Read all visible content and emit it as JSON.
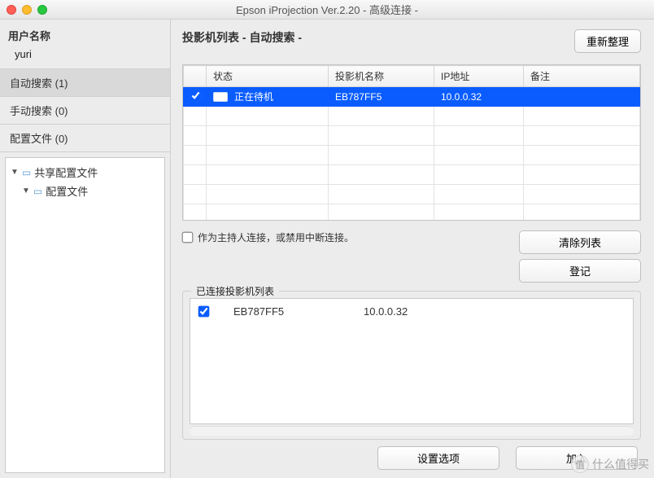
{
  "window": {
    "title": "Epson iProjection Ver.2.20 - 高级连接 -"
  },
  "sidebar": {
    "user_label": "用户名称",
    "username": "yuri",
    "items": [
      {
        "label": "自动搜索 (1)",
        "active": true
      },
      {
        "label": "手动搜索 (0)",
        "active": false
      },
      {
        "label": "配置文件 (0)",
        "active": false
      }
    ],
    "tree": [
      {
        "label": "共享配置文件"
      },
      {
        "label": "配置文件"
      }
    ]
  },
  "main": {
    "title": "投影机列表 - 自动搜索 -",
    "refresh_btn": "重新整理",
    "columns": {
      "status": "状态",
      "name": "投影机名称",
      "ip": "IP地址",
      "note": "备注"
    },
    "rows": [
      {
        "checked": true,
        "status": "正在待机",
        "name": "EB787FF5",
        "ip": "10.0.0.32",
        "note": ""
      }
    ],
    "host_checkbox_label": "作为主持人连接，或禁用中断连接。",
    "clear_btn": "清除列表",
    "register_btn": "登记"
  },
  "connected": {
    "group_title": "已连接投影机列表",
    "items": [
      {
        "checked": true,
        "name": "EB787FF5",
        "ip": "10.0.0.32"
      }
    ]
  },
  "bottom": {
    "options_btn": "设置选项",
    "join_btn": "加入"
  },
  "watermark": "什么值得买"
}
